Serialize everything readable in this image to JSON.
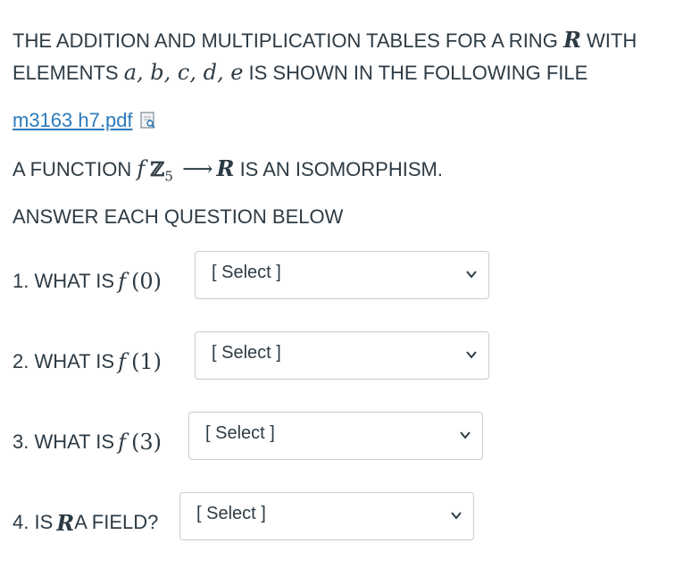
{
  "intro": {
    "line1_pre": "THE ADDITION AND MULTIPLICATION TABLES FOR A RING ",
    "ring_symbol": "R",
    "line1_post": " WITH",
    "line2_pre": "ELEMENTS ",
    "elements": "a, b, c, d, e",
    "line2_post": " IS SHOWN IN THE FOLLOWING FILE"
  },
  "file": {
    "name": "m3163 h7.pdf",
    "icon": "document-preview-icon"
  },
  "function_line": {
    "pre": "A FUNCTION ",
    "f": "f",
    "domain": "ℤ",
    "domain_sub": "5",
    "arrow": "⟶",
    "codomain": "R",
    "post": " IS AN ISOMORPHISM."
  },
  "instruction": "ANSWER EACH QUESTION BELOW",
  "questions": [
    {
      "prefix": "1.  WHAT IS ",
      "f": "f",
      "arg": "(0)",
      "selected": "[ Select ]"
    },
    {
      "prefix": "2.  WHAT IS ",
      "f": "f",
      "arg": "(1)",
      "selected": "[ Select ]"
    },
    {
      "prefix": "3. WHAT IS ",
      "f": "f",
      "arg": "(3)",
      "selected": "[ Select ]"
    },
    {
      "prefix": "4.  IS ",
      "ring": "R",
      "post": " A FIELD?",
      "selected": "[ Select ]"
    }
  ],
  "colors": {
    "text": "#2d3b45",
    "link": "#2b7abc",
    "border": "#c7cdd1"
  }
}
